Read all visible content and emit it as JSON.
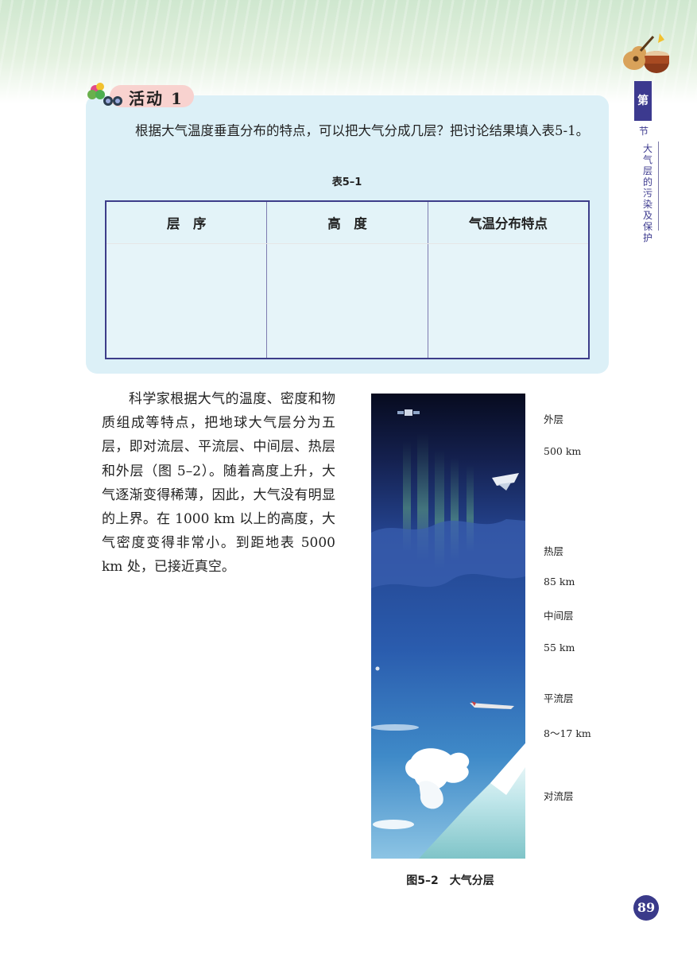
{
  "side_tab": {
    "number": "第",
    "sub": "节",
    "title": "大气层的污染及保护"
  },
  "activity": {
    "label": "活动 1",
    "text": "根据大气温度垂直分布的特点，可以把大气分成几层？把讨论结果填入表5-1。"
  },
  "table": {
    "caption": "表5–1",
    "headers": [
      "层　序",
      "高　度",
      "气温分布特点"
    ]
  },
  "body": {
    "paragraph": "科学家根据大气的温度、密度和物质组成等特点，把地球大气层分为五层，即对流层、平流层、中间层、热层和外层（图 5–2）。随着高度上升，大气逐渐变得稀薄，因此，大气没有明显的上界。在 1000 km 以上的高度，大气密度变得非常小。到距地表 5000 km 处，已接近真空。"
  },
  "figure": {
    "labels": [
      "外层",
      "500 km",
      "热层",
      "85 km",
      "中间层",
      "55 km",
      "平流层",
      "8～17 km",
      "对流层"
    ],
    "caption": "图5–2　大气分层"
  },
  "page_number": "89",
  "colors": {
    "accent": "#3c3a8f",
    "activity_bg": "#dcf0f7",
    "badge_pink": "#f8d2cf"
  },
  "icons": [
    "guitar-drum-icon",
    "flower-binoculars-icon",
    "satellite-icon",
    "space-shuttle-icon",
    "balloon-icon",
    "jet-plane-icon"
  ]
}
